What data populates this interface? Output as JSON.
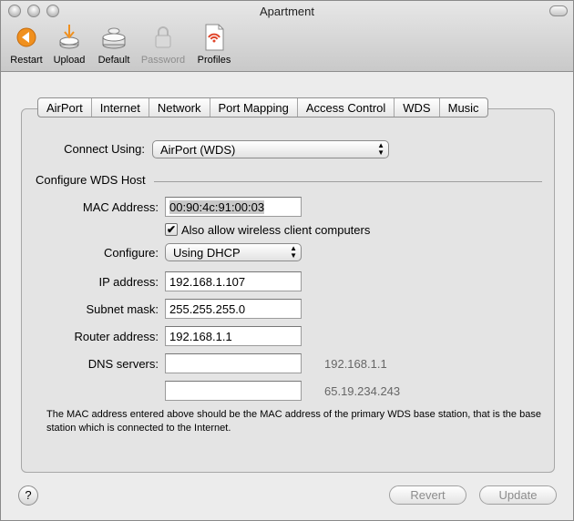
{
  "window": {
    "title": "Apartment"
  },
  "toolbar": {
    "items": [
      {
        "label": "Restart",
        "icon": "restart-icon",
        "enabled": true
      },
      {
        "label": "Upload",
        "icon": "upload-icon",
        "enabled": true
      },
      {
        "label": "Default",
        "icon": "default-icon",
        "enabled": true
      },
      {
        "label": "Password",
        "icon": "lock-icon",
        "enabled": false
      },
      {
        "label": "Profiles",
        "icon": "profiles-icon",
        "enabled": true
      }
    ]
  },
  "tabs": [
    "AirPort",
    "Internet",
    "Network",
    "Port Mapping",
    "Access Control",
    "WDS",
    "Music"
  ],
  "connect": {
    "label": "Connect Using:",
    "value": "AirPort (WDS)"
  },
  "section_title": "Configure WDS Host",
  "mac": {
    "label": "MAC Address:",
    "value": "00:90:4c:91:00:03"
  },
  "allow_wireless": {
    "label": "Also allow wireless client computers",
    "checked": true
  },
  "configure": {
    "label": "Configure:",
    "value": "Using DHCP"
  },
  "ip": {
    "label": "IP address:",
    "value": "192.168.1.107"
  },
  "subnet": {
    "label": "Subnet mask:",
    "value": "255.255.255.0"
  },
  "router": {
    "label": "Router address:",
    "value": "192.168.1.1"
  },
  "dns": {
    "label": "DNS servers:",
    "primary": "",
    "secondary": "",
    "hint1": "192.168.1.1",
    "hint2": "65.19.234.243"
  },
  "note": "The MAC address entered above should be the MAC address of the primary WDS base station, that is the base station which is connected to the Internet.",
  "buttons": {
    "help": "?",
    "revert": "Revert",
    "update": "Update"
  },
  "colors": {
    "accent_orange": "#f0901e"
  }
}
